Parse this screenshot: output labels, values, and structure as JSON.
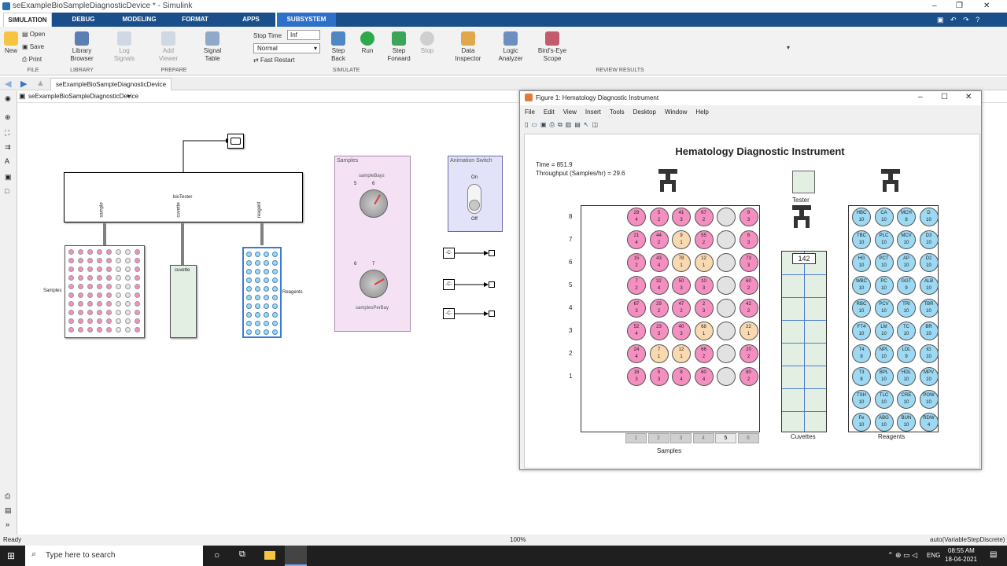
{
  "window": {
    "title": "seExampleBioSampleDiagnosticDevice * - Simulink"
  },
  "tabs": [
    "SIMULATION",
    "DEBUG",
    "MODELING",
    "FORMAT",
    "APPS",
    "SUBSYSTEM BLOCK"
  ],
  "ribbon": {
    "file": {
      "new": "New",
      "open": "Open",
      "save": "Save",
      "print": "Print",
      "group": "FILE"
    },
    "library": {
      "label1": "Library",
      "label2": "Browser",
      "group": "LIBRARY"
    },
    "prepare": {
      "log1": "Log",
      "log2": "Signals",
      "add1": "Add",
      "add2": "Viewer",
      "sig1": "Signal",
      "sig2": "Table",
      "group": "PREPARE"
    },
    "simulate": {
      "stop_time_label": "Stop Time",
      "stop_time_value": "Inf",
      "mode": "Normal",
      "fast_restart": "Fast Restart",
      "step_back1": "Step",
      "step_back2": "Back",
      "run": "Run",
      "step_fwd1": "Step",
      "step_fwd2": "Forward",
      "stop": "Stop",
      "group": "SIMULATE"
    },
    "review": {
      "data1": "Data",
      "data2": "Inspector",
      "logic1": "Logic",
      "logic2": "Analyzer",
      "bird1": "Bird's-Eye",
      "bird2": "Scope",
      "group": "REVIEW RESULTS"
    }
  },
  "nav": {
    "tab": "seExampleBioSampleDiagnosticDevice"
  },
  "address": {
    "path": "seExampleBioSampleDiagnosticDevice"
  },
  "model": {
    "biotester": "bioTester",
    "port_sample": "sample",
    "port_cuvette": "cuvette",
    "port_reagent": "reagent",
    "samples_label": "Samples",
    "cuvette_label": "cuvette",
    "reagents_label": "Reagents",
    "panel_title": "Samples",
    "knob1": "sampleBays",
    "knob2": "samplesPerBay",
    "switch_title": "Animation Switch",
    "switch_on": "On",
    "switch_off": "Off",
    "const": "-C-"
  },
  "figure": {
    "title": "Figure 1: Hematology Diagnostic Instrument",
    "menu": [
      "File",
      "Edit",
      "View",
      "Insert",
      "Tools",
      "Desktop",
      "Window",
      "Help"
    ],
    "heading": "Hematology Diagnostic Instrument",
    "time": "Time = 851.9",
    "throughput": "Throughput (Samples/hr) = 29.6",
    "tester": "Tester",
    "cuvette_count": "142",
    "samples_label": "Samples",
    "cuvettes_label": "Cuvettes",
    "reagents_label": "Reagents",
    "row_labels": [
      "8",
      "7",
      "6",
      "5",
      "4",
      "3",
      "2",
      "1"
    ],
    "bay_labels": [
      "1",
      "2",
      "3",
      "4",
      "5",
      "6"
    ],
    "sample_rows": [
      [
        [
          "29",
          "4",
          "p"
        ],
        [
          "5",
          "2",
          "p"
        ],
        [
          "41",
          "3",
          "p"
        ],
        [
          "67",
          "2",
          "p"
        ],
        [
          "",
          "",
          "g"
        ],
        [
          "9",
          "3",
          "p"
        ]
      ],
      [
        [
          "21",
          "4",
          "p"
        ],
        [
          "44",
          "2",
          "p"
        ],
        [
          "9",
          "1",
          "e"
        ],
        [
          "55",
          "2",
          "p"
        ],
        [
          "",
          "",
          "g"
        ],
        [
          "6",
          "3",
          "p"
        ]
      ],
      [
        [
          "15",
          "2",
          "p"
        ],
        [
          "43",
          "4",
          "p"
        ],
        [
          "78",
          "1",
          "e"
        ],
        [
          "12",
          "1",
          "e"
        ],
        [
          "",
          "",
          "g"
        ],
        [
          "73",
          "3",
          "p"
        ]
      ],
      [
        [
          "7",
          "2",
          "p"
        ],
        [
          "32",
          "4",
          "p"
        ],
        [
          "50",
          "3",
          "p"
        ],
        [
          "10",
          "3",
          "p"
        ],
        [
          "",
          "",
          "g"
        ],
        [
          "60",
          "2",
          "p"
        ]
      ],
      [
        [
          "67",
          "3",
          "p"
        ],
        [
          "29",
          "2",
          "p"
        ],
        [
          "47",
          "2",
          "p"
        ],
        [
          "2",
          "3",
          "p"
        ],
        [
          "",
          "",
          "g"
        ],
        [
          "42",
          "2",
          "p"
        ]
      ],
      [
        [
          "52",
          "4",
          "p"
        ],
        [
          "23",
          "3",
          "p"
        ],
        [
          "40",
          "3",
          "p"
        ],
        [
          "68",
          "1",
          "e"
        ],
        [
          "",
          "",
          "g"
        ],
        [
          "22",
          "1",
          "e"
        ]
      ],
      [
        [
          "24",
          "4",
          "p"
        ],
        [
          "7",
          "1",
          "e"
        ],
        [
          "12",
          "1",
          "e"
        ],
        [
          "66",
          "2",
          "p"
        ],
        [
          "",
          "",
          "g"
        ],
        [
          "20",
          "2",
          "p"
        ]
      ],
      [
        [
          "16",
          "3",
          "p"
        ],
        [
          "5",
          "3",
          "p"
        ],
        [
          "8",
          "4",
          "p"
        ],
        [
          "60",
          "4",
          "p"
        ],
        [
          "",
          "",
          "g"
        ],
        [
          "80",
          "2",
          "p"
        ]
      ]
    ],
    "reagent_rows": [
      [
        [
          "HBC",
          "10"
        ],
        [
          "CA",
          "10"
        ],
        [
          "MCH",
          "8"
        ],
        [
          "D",
          "10"
        ]
      ],
      [
        [
          "TBC",
          "10"
        ],
        [
          "PLC",
          "10"
        ],
        [
          "MCV",
          "10"
        ],
        [
          "D3",
          "10"
        ]
      ],
      [
        [
          "HG",
          "10"
        ],
        [
          "PCT",
          "10"
        ],
        [
          "AP",
          "10"
        ],
        [
          "D2",
          "10"
        ]
      ],
      [
        [
          "WBC",
          "10"
        ],
        [
          "PC",
          "10"
        ],
        [
          "GGT",
          "9"
        ],
        [
          "ALB",
          "10"
        ]
      ],
      [
        [
          "RBC",
          "10"
        ],
        [
          "PCV",
          "10"
        ],
        [
          "TRI",
          "10"
        ],
        [
          "TBR",
          "10"
        ]
      ],
      [
        [
          "FT4",
          "10"
        ],
        [
          "LM",
          "10"
        ],
        [
          "TC",
          "10"
        ],
        [
          "BR",
          "10"
        ]
      ],
      [
        [
          "T4",
          "8"
        ],
        [
          "NPL",
          "10"
        ],
        [
          "LDL",
          "9"
        ],
        [
          "IG",
          "10"
        ]
      ],
      [
        [
          "T3",
          "8"
        ],
        [
          "BPL",
          "10"
        ],
        [
          "HDL",
          "10"
        ],
        [
          "MPV",
          "10"
        ]
      ],
      [
        [
          "TSH",
          "10"
        ],
        [
          "TLC",
          "10"
        ],
        [
          "CRE",
          "10"
        ],
        [
          "POW",
          "10"
        ]
      ],
      [
        [
          "Fe",
          "10"
        ],
        [
          "ABG",
          "10"
        ],
        [
          "BUN",
          "10"
        ],
        [
          "RDW",
          "4"
        ]
      ]
    ]
  },
  "status": {
    "left": "Ready",
    "zoom": "100%",
    "solver": "auto(VariableStepDiscrete)"
  },
  "taskbar": {
    "search": "Type here to search",
    "lang": "ENG",
    "time": "08:55 AM",
    "date": "18-04-2021"
  }
}
